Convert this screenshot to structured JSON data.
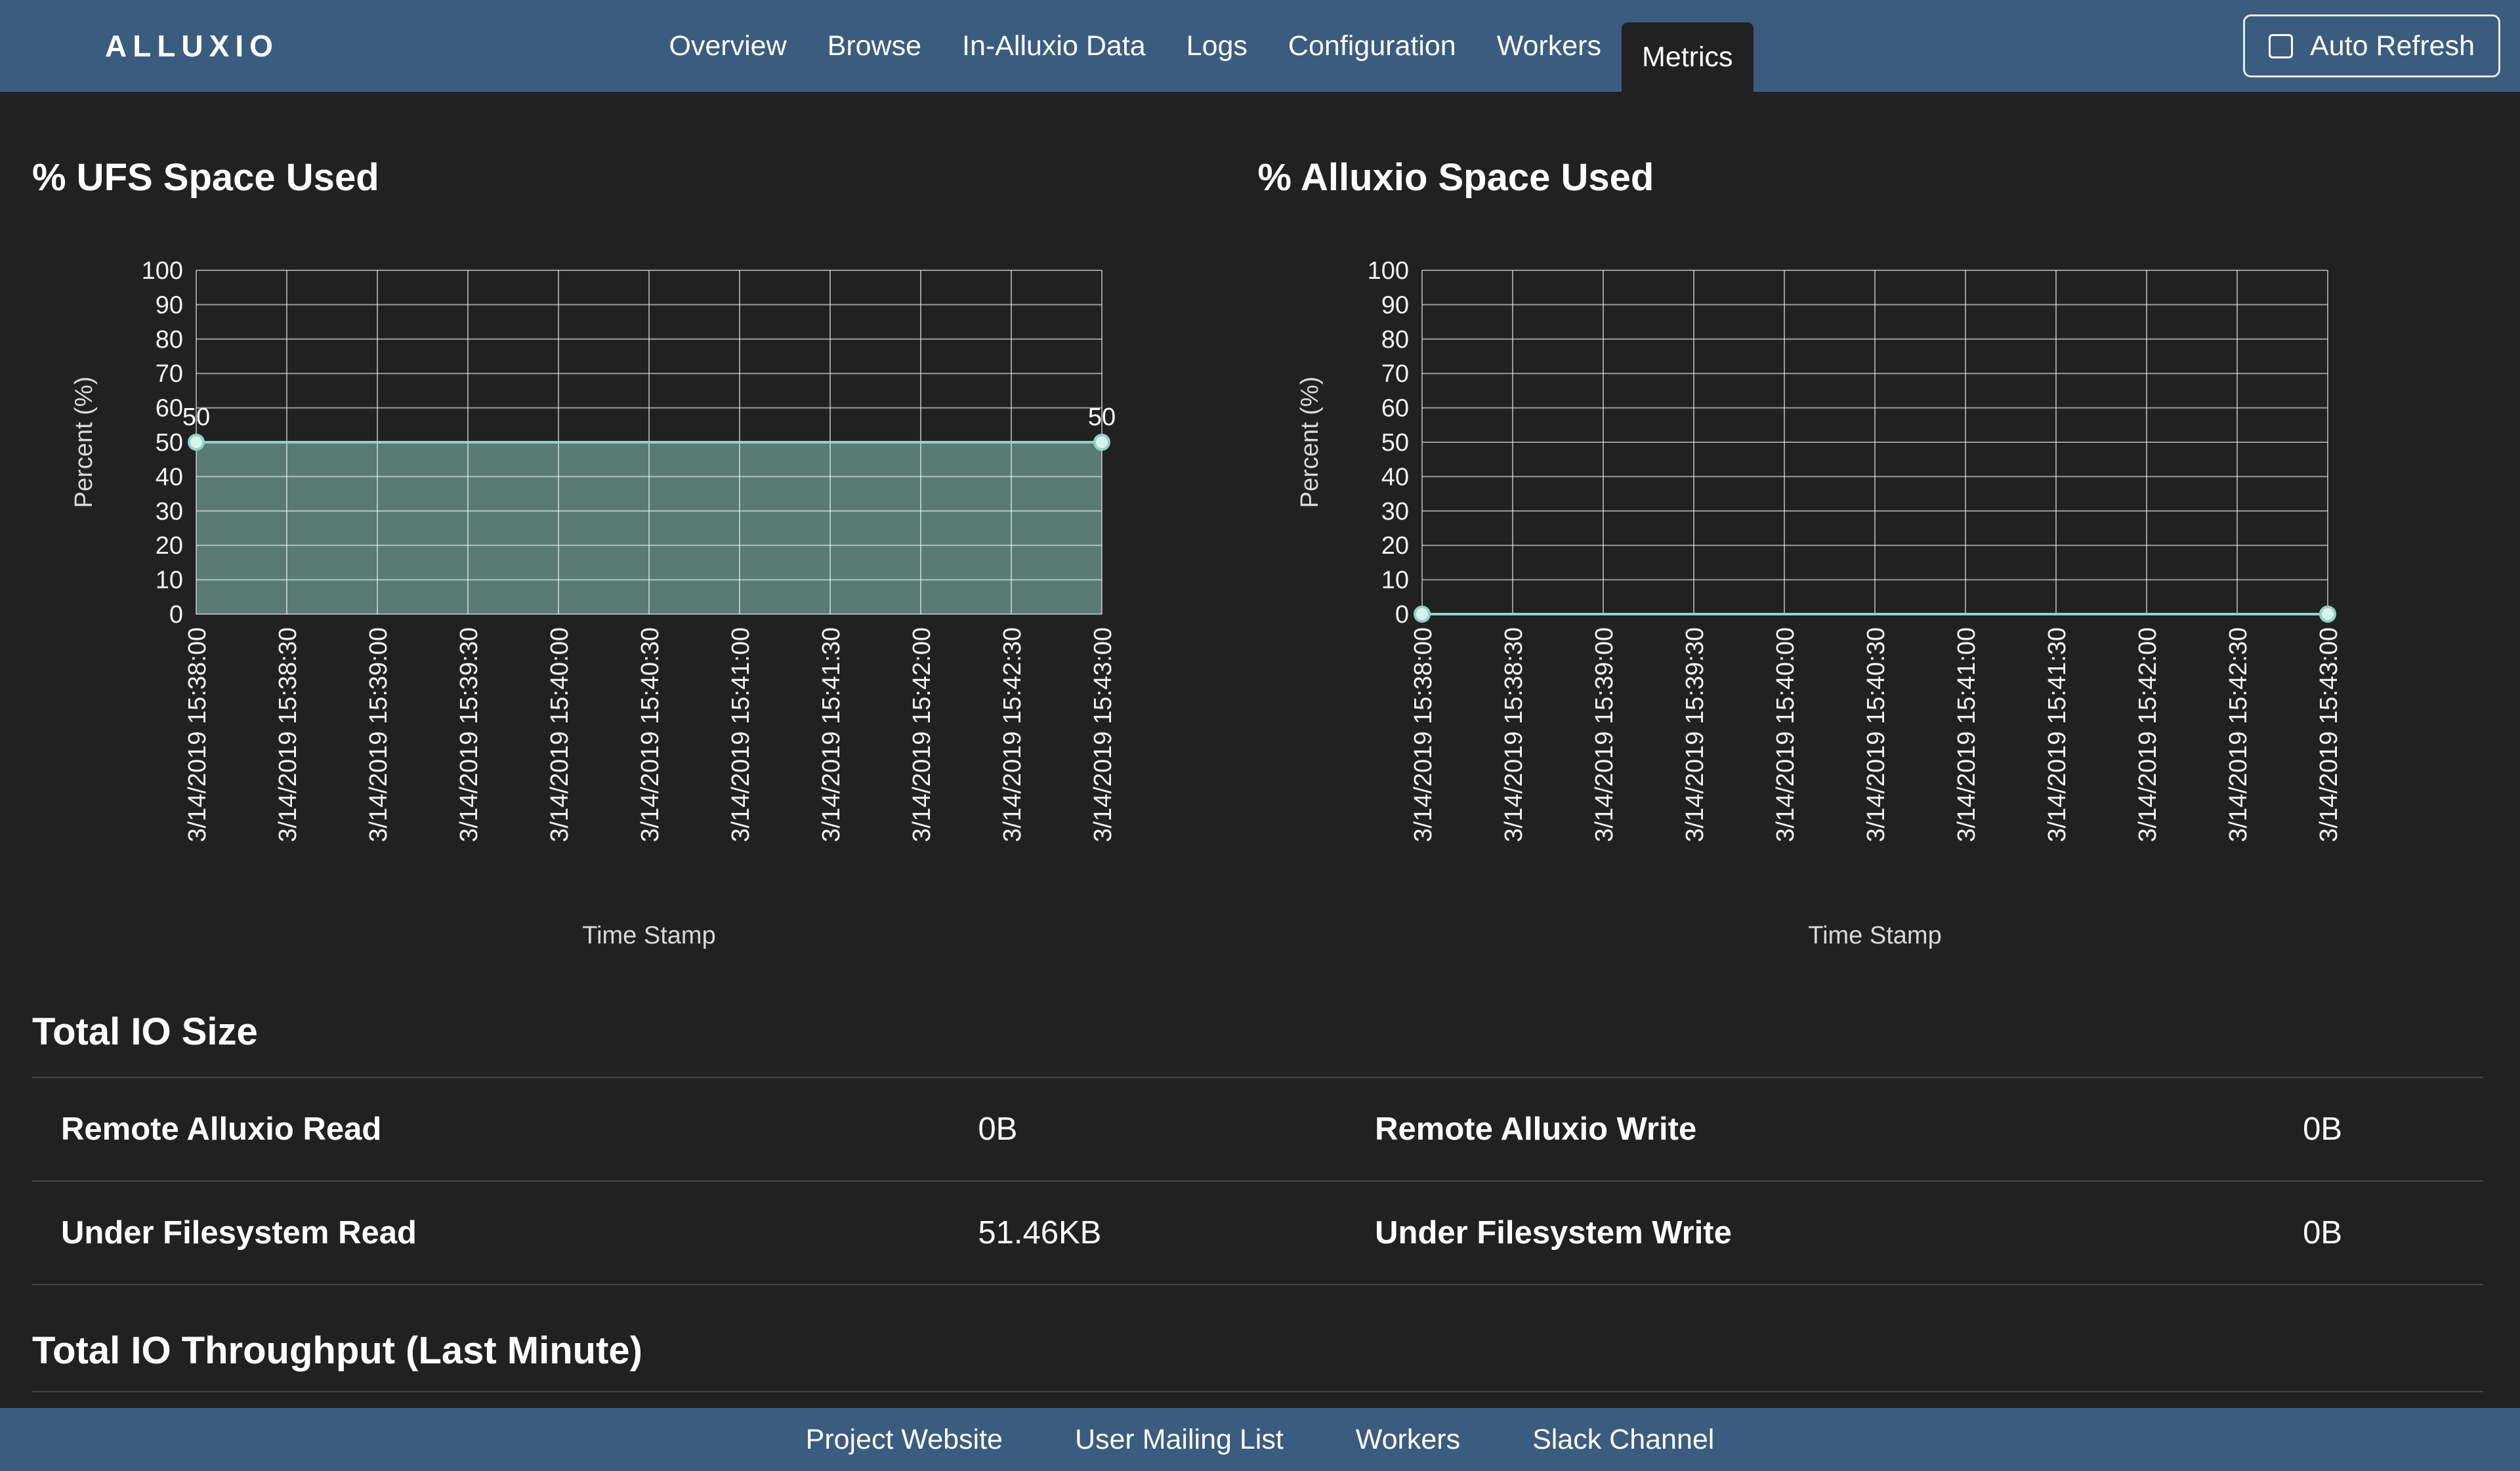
{
  "navbar": {
    "brand": "ALLUXIO",
    "items": [
      {
        "label": "Overview",
        "active": false
      },
      {
        "label": "Browse",
        "active": false
      },
      {
        "label": "In-Alluxio Data",
        "active": false
      },
      {
        "label": "Logs",
        "active": false
      },
      {
        "label": "Configuration",
        "active": false
      },
      {
        "label": "Workers",
        "active": false
      },
      {
        "label": "Metrics",
        "active": true
      }
    ],
    "auto_refresh": {
      "label": "Auto Refresh",
      "checked": false
    }
  },
  "chart_style": {
    "line_color": "#8fd4c6",
    "fill_color": "rgba(136,199,184,0.55)",
    "point_fill": "#d8f3ec",
    "grid_color": "rgba(255,255,255,0.55)",
    "tick_color": "#f2f2f2",
    "axis_color": "#d9d9d9"
  },
  "chart_data": [
    {
      "type": "area",
      "title": "% UFS Space Used",
      "xlabel": "Time Stamp",
      "ylabel": "Percent (%)",
      "ylim": [
        0,
        100
      ],
      "ytick_step": 10,
      "grid": true,
      "legend": "none",
      "categories": [
        "3/14/2019 15:38:00",
        "3/14/2019 15:38:30",
        "3/14/2019 15:39:00",
        "3/14/2019 15:39:30",
        "3/14/2019 15:40:00",
        "3/14/2019 15:40:30",
        "3/14/2019 15:41:00",
        "3/14/2019 15:41:30",
        "3/14/2019 15:42:00",
        "3/14/2019 15:42:30",
        "3/14/2019 15:43:00"
      ],
      "values": [
        50,
        50,
        50,
        50,
        50,
        50,
        50,
        50,
        50,
        50,
        50
      ],
      "point_labels": [
        {
          "index": 0,
          "text": "50"
        },
        {
          "index": 10,
          "text": "50"
        }
      ]
    },
    {
      "type": "area",
      "title": "% Alluxio Space Used",
      "xlabel": "Time Stamp",
      "ylabel": "Percent (%)",
      "ylim": [
        0,
        100
      ],
      "ytick_step": 10,
      "grid": true,
      "legend": "none",
      "categories": [
        "3/14/2019 15:38:00",
        "3/14/2019 15:38:30",
        "3/14/2019 15:39:00",
        "3/14/2019 15:39:30",
        "3/14/2019 15:40:00",
        "3/14/2019 15:40:30",
        "3/14/2019 15:41:00",
        "3/14/2019 15:41:30",
        "3/14/2019 15:42:00",
        "3/14/2019 15:42:30",
        "3/14/2019 15:43:00"
      ],
      "values": [
        0,
        0,
        0,
        0,
        0,
        0,
        0,
        0,
        0,
        0,
        0
      ],
      "point_labels": []
    }
  ],
  "total_io_size": {
    "title": "Total IO Size",
    "rows": [
      [
        {
          "label": "Remote Alluxio Read",
          "value": "0B"
        },
        {
          "label": "Remote Alluxio Write",
          "value": "0B"
        }
      ],
      [
        {
          "label": "Under Filesystem Read",
          "value": "51.46KB"
        },
        {
          "label": "Under Filesystem Write",
          "value": "0B"
        }
      ]
    ]
  },
  "total_io_throughput": {
    "title": "Total IO Throughput (Last Minute)"
  },
  "footer": {
    "links": [
      "Project Website",
      "User Mailing List",
      "Workers",
      "Slack Channel"
    ]
  },
  "colors": {
    "navbar_bg": "#3a5c7e",
    "page_bg": "#212121",
    "divider": "#464646"
  }
}
